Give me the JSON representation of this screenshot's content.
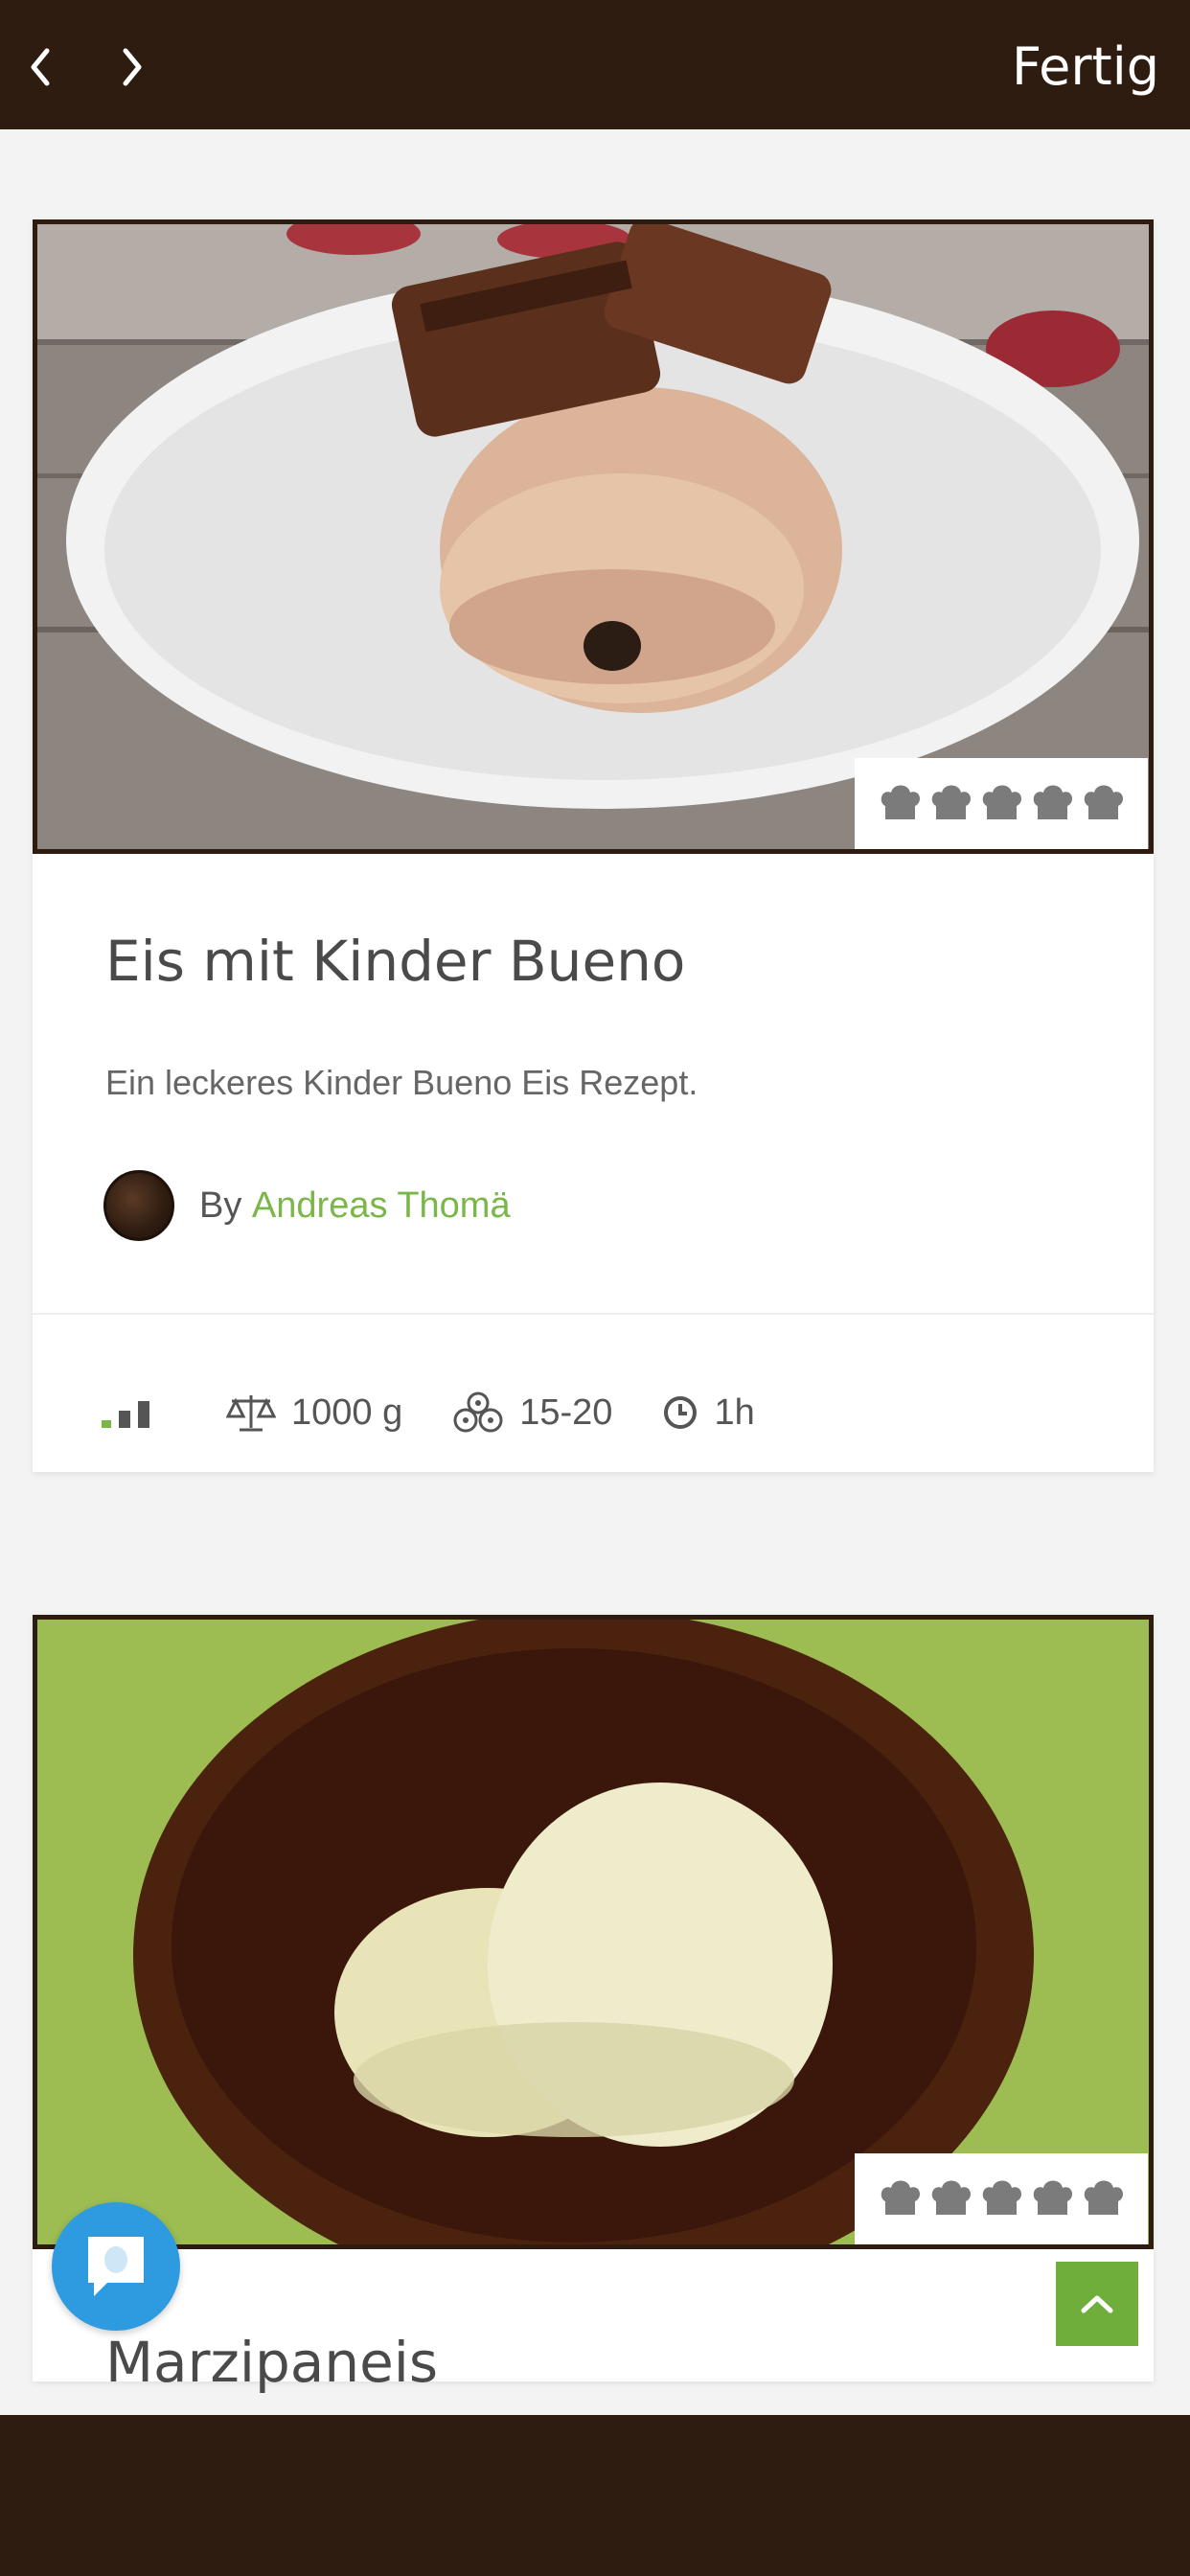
{
  "header": {
    "back_icon": "chevron-left-icon",
    "forward_icon": "chevron-right-icon",
    "done_label": "Fertig"
  },
  "recipes": [
    {
      "title": "Eis mit Kinder Bueno",
      "description": "Ein leckeres Kinder Bueno Eis Rezept.",
      "by_label": "By",
      "author": "Andreas Thomä",
      "rating_icons": 5,
      "difficulty_icon": "difficulty-bars-icon",
      "weight": "1000 g",
      "servings": "15-20",
      "time": "1h"
    },
    {
      "title": "Marzipaneis",
      "rating_icons": 5
    }
  ],
  "colors": {
    "bar": "#2e1c10",
    "accent_green": "#7ab648",
    "chat_blue": "#2e9be0",
    "scroll_top_green": "#6fae3a"
  },
  "floating": {
    "chat_icon": "chat-bubble-icon",
    "scroll_top_icon": "chevron-up-icon"
  }
}
